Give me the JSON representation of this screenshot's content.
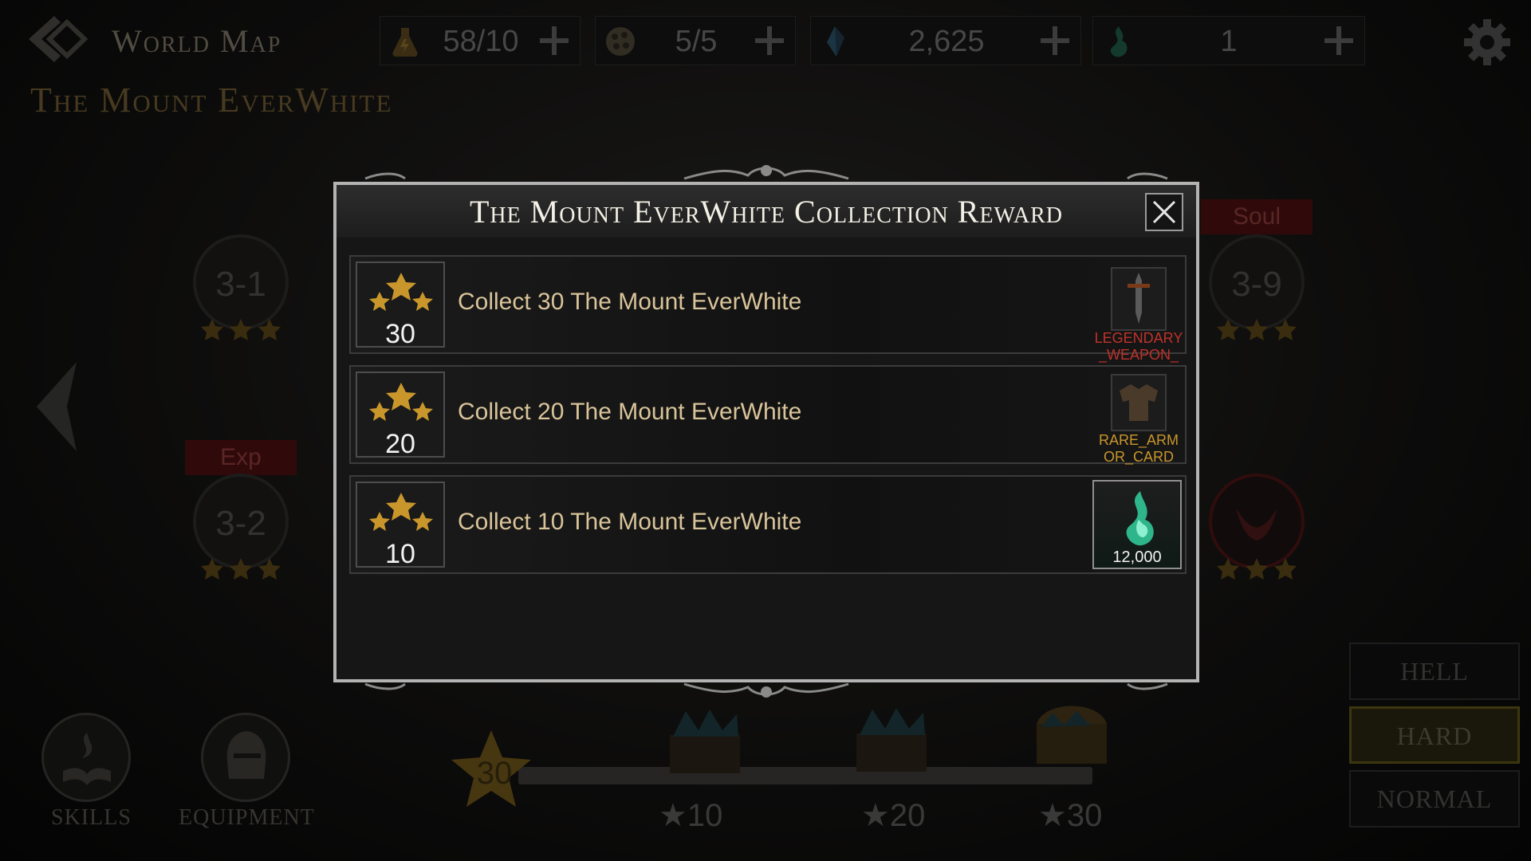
{
  "header": {
    "world_title": "World Map",
    "map_title": "The Mount EverWhite"
  },
  "resources": [
    {
      "icon": "stamina-flask-icon",
      "value": "58/10"
    },
    {
      "icon": "ticket-icon",
      "value": "5/5"
    },
    {
      "icon": "blue-crystal-icon",
      "value": "2,625"
    },
    {
      "icon": "green-soul-flame-icon",
      "value": "1"
    }
  ],
  "stages": [
    {
      "label": "3-1",
      "stars": 3
    },
    {
      "label": "3-2",
      "stars": 3,
      "ribbon": "Exp"
    },
    {
      "label": "3-9",
      "stars": 3,
      "ribbon": "Soul"
    },
    {
      "label": "",
      "stars": 3
    }
  ],
  "bottom": {
    "skills_label": "SKILLS",
    "equipment_label": "EQUIPMENT",
    "current_stars": "30",
    "progress_fraction": 1.0,
    "milestones": [
      "10",
      "20",
      "30"
    ]
  },
  "difficulty": {
    "hell": "HELL",
    "hard": "HARD",
    "normal": "NORMAL",
    "selected": "HARD"
  },
  "modal": {
    "title": "The Mount EverWhite Collection Reward",
    "rows": [
      {
        "count": "30",
        "text": "Collect 30 The Mount EverWhite",
        "reward_label": "LEGENDARY_WEAPON_CARD",
        "reward_color": "#c0322a"
      },
      {
        "count": "20",
        "text": "Collect 20 The Mount EverWhite",
        "reward_label": "RARE_ARMOR_CARD",
        "reward_color": "#c9962c"
      },
      {
        "count": "10",
        "text": "Collect 10 The Mount EverWhite",
        "reward_qty": "12,000",
        "reward_icon": "green-soul-flame-icon"
      }
    ]
  },
  "colors": {
    "gold": "#c9962c",
    "legendary_red": "#c0322a",
    "modal_border": "#b3b3b3"
  }
}
